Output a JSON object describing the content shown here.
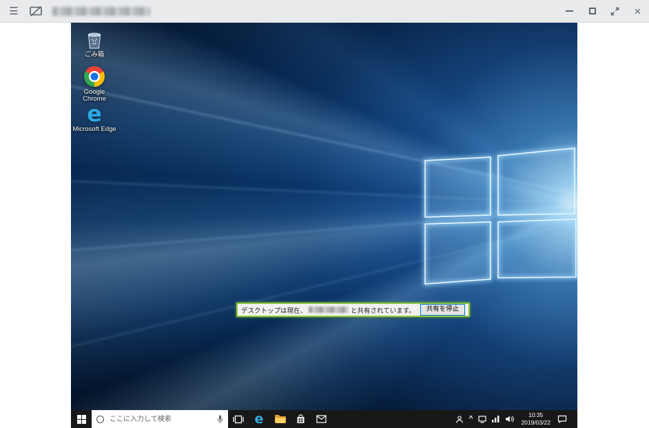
{
  "titlebar": {
    "title_visible": false
  },
  "glyphs": {
    "menu": "☰",
    "close": "×",
    "chevron_up": "^"
  },
  "desktop": {
    "icons": [
      {
        "name": "recycle-bin",
        "label": "ごみ箱"
      },
      {
        "name": "google-chrome",
        "label": "Google Chrome"
      },
      {
        "name": "microsoft-edge",
        "label": "Microsoft Edge"
      }
    ],
    "share_banner": {
      "prefix": "デスクトップは現在、",
      "redacted": true,
      "suffix": "と共有されています。",
      "button": "共有を停止"
    }
  },
  "taskbar": {
    "search": {
      "placeholder": "ここに入力して検索"
    },
    "clock": {
      "time": "10:35",
      "date": "2019/03/22"
    }
  },
  "colors": {
    "banner_border": "#8dc63f",
    "button_focus_border": "#0078d7",
    "taskbar_bg": "#181818",
    "titlebar_bg": "#e9eaec",
    "wallpaper_base": "#072a55"
  }
}
